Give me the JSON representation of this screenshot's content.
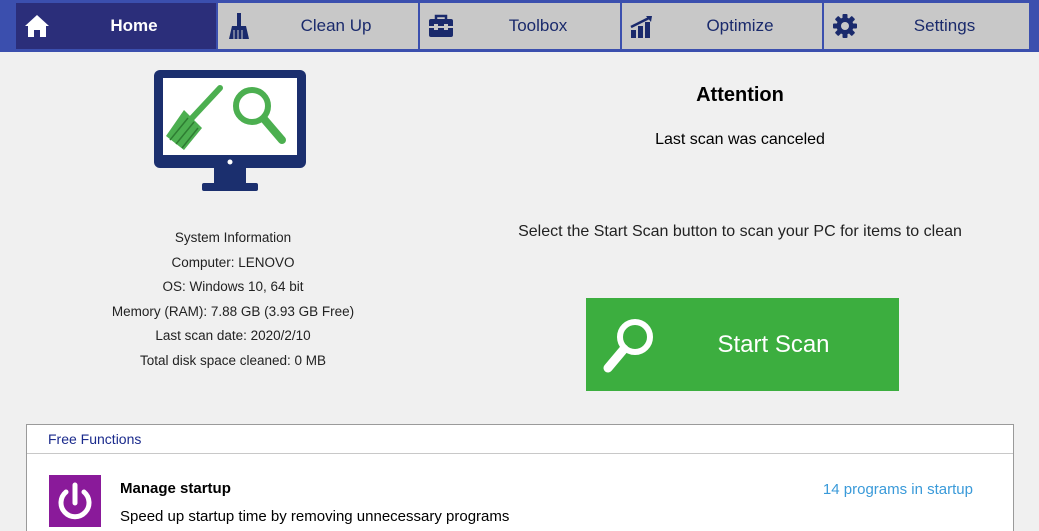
{
  "nav": {
    "tabs": [
      {
        "label": "Home",
        "icon": "home-icon",
        "active": true
      },
      {
        "label": "Clean Up",
        "icon": "broom-icon",
        "active": false
      },
      {
        "label": "Toolbox",
        "icon": "toolbox-icon",
        "active": false
      },
      {
        "label": "Optimize",
        "icon": "bar-chart-icon",
        "active": false
      },
      {
        "label": "Settings",
        "icon": "gear-icon",
        "active": false
      }
    ]
  },
  "system": {
    "heading": "System Information",
    "computer": "Computer: LENOVO",
    "os": "OS: Windows 10, 64 bit",
    "memory": "Memory (RAM): 7.88 GB (3.93 GB Free)",
    "last_scan": "Last scan date: 2020/2/10",
    "disk_cleaned": "Total disk space cleaned: 0  MB"
  },
  "attention": {
    "title": "Attention",
    "subtitle": "Last scan was canceled",
    "description": "Select the Start Scan button to scan your PC for items to clean"
  },
  "scan_button": {
    "label": "Start Scan",
    "icon": "magnifier-icon",
    "color": "#3cae3f"
  },
  "free_functions": {
    "header": "Free Functions",
    "items": [
      {
        "title": "Manage startup",
        "description": "Speed up startup time by removing unnecessary programs",
        "status": "14 programs in startup",
        "icon": "power-icon"
      }
    ]
  },
  "colors": {
    "accent": "#3b4fae",
    "active_tab": "#2b2e7a",
    "scan_green": "#3cae3f",
    "startup_purple": "#8a1a9a",
    "link": "#3a9ad9"
  }
}
